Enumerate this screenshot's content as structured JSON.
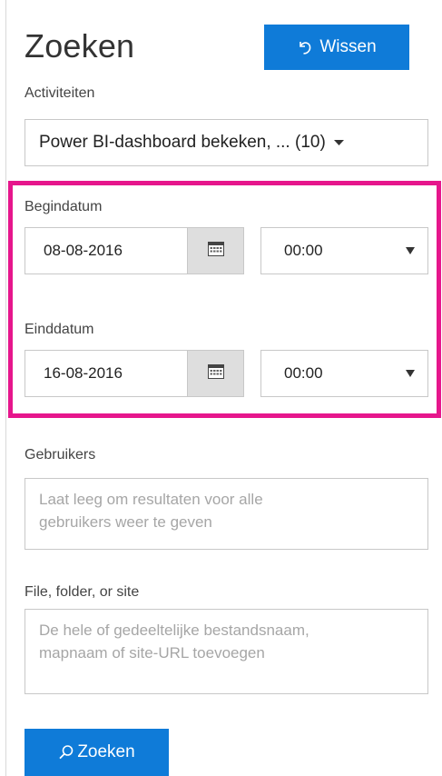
{
  "page_title": "Zoeken",
  "clear_button": {
    "label": "Wissen",
    "icon": "undo-icon"
  },
  "activities": {
    "label": "Activiteiten",
    "selected": "Power BI-dashboard bekeken, ... (10)",
    "icon": "caret-down-icon"
  },
  "start": {
    "label": "Begindatum",
    "date": "08-08-2016",
    "time": "00:00",
    "calendar_icon": "calendar-icon"
  },
  "end": {
    "label": "Einddatum",
    "date": "16-08-2016",
    "time": "00:00",
    "calendar_icon": "calendar-icon"
  },
  "users": {
    "label": "Gebruikers",
    "placeholder_line1": "Laat leeg om resultaten voor alle",
    "placeholder_line2": "gebruikers weer te geven"
  },
  "file": {
    "label": "File, folder, or site",
    "placeholder_line1": "De hele of gedeeltelijke bestandsnaam,",
    "placeholder_line2": "mapnaam of site-URL toevoegen"
  },
  "search_button": {
    "label": "Zoeken",
    "icon": "search-icon"
  },
  "colors": {
    "accent": "#0f7bd8",
    "highlight": "#e6168c",
    "border": "#c8c8c8",
    "placeholder": "#a6a6a6"
  }
}
